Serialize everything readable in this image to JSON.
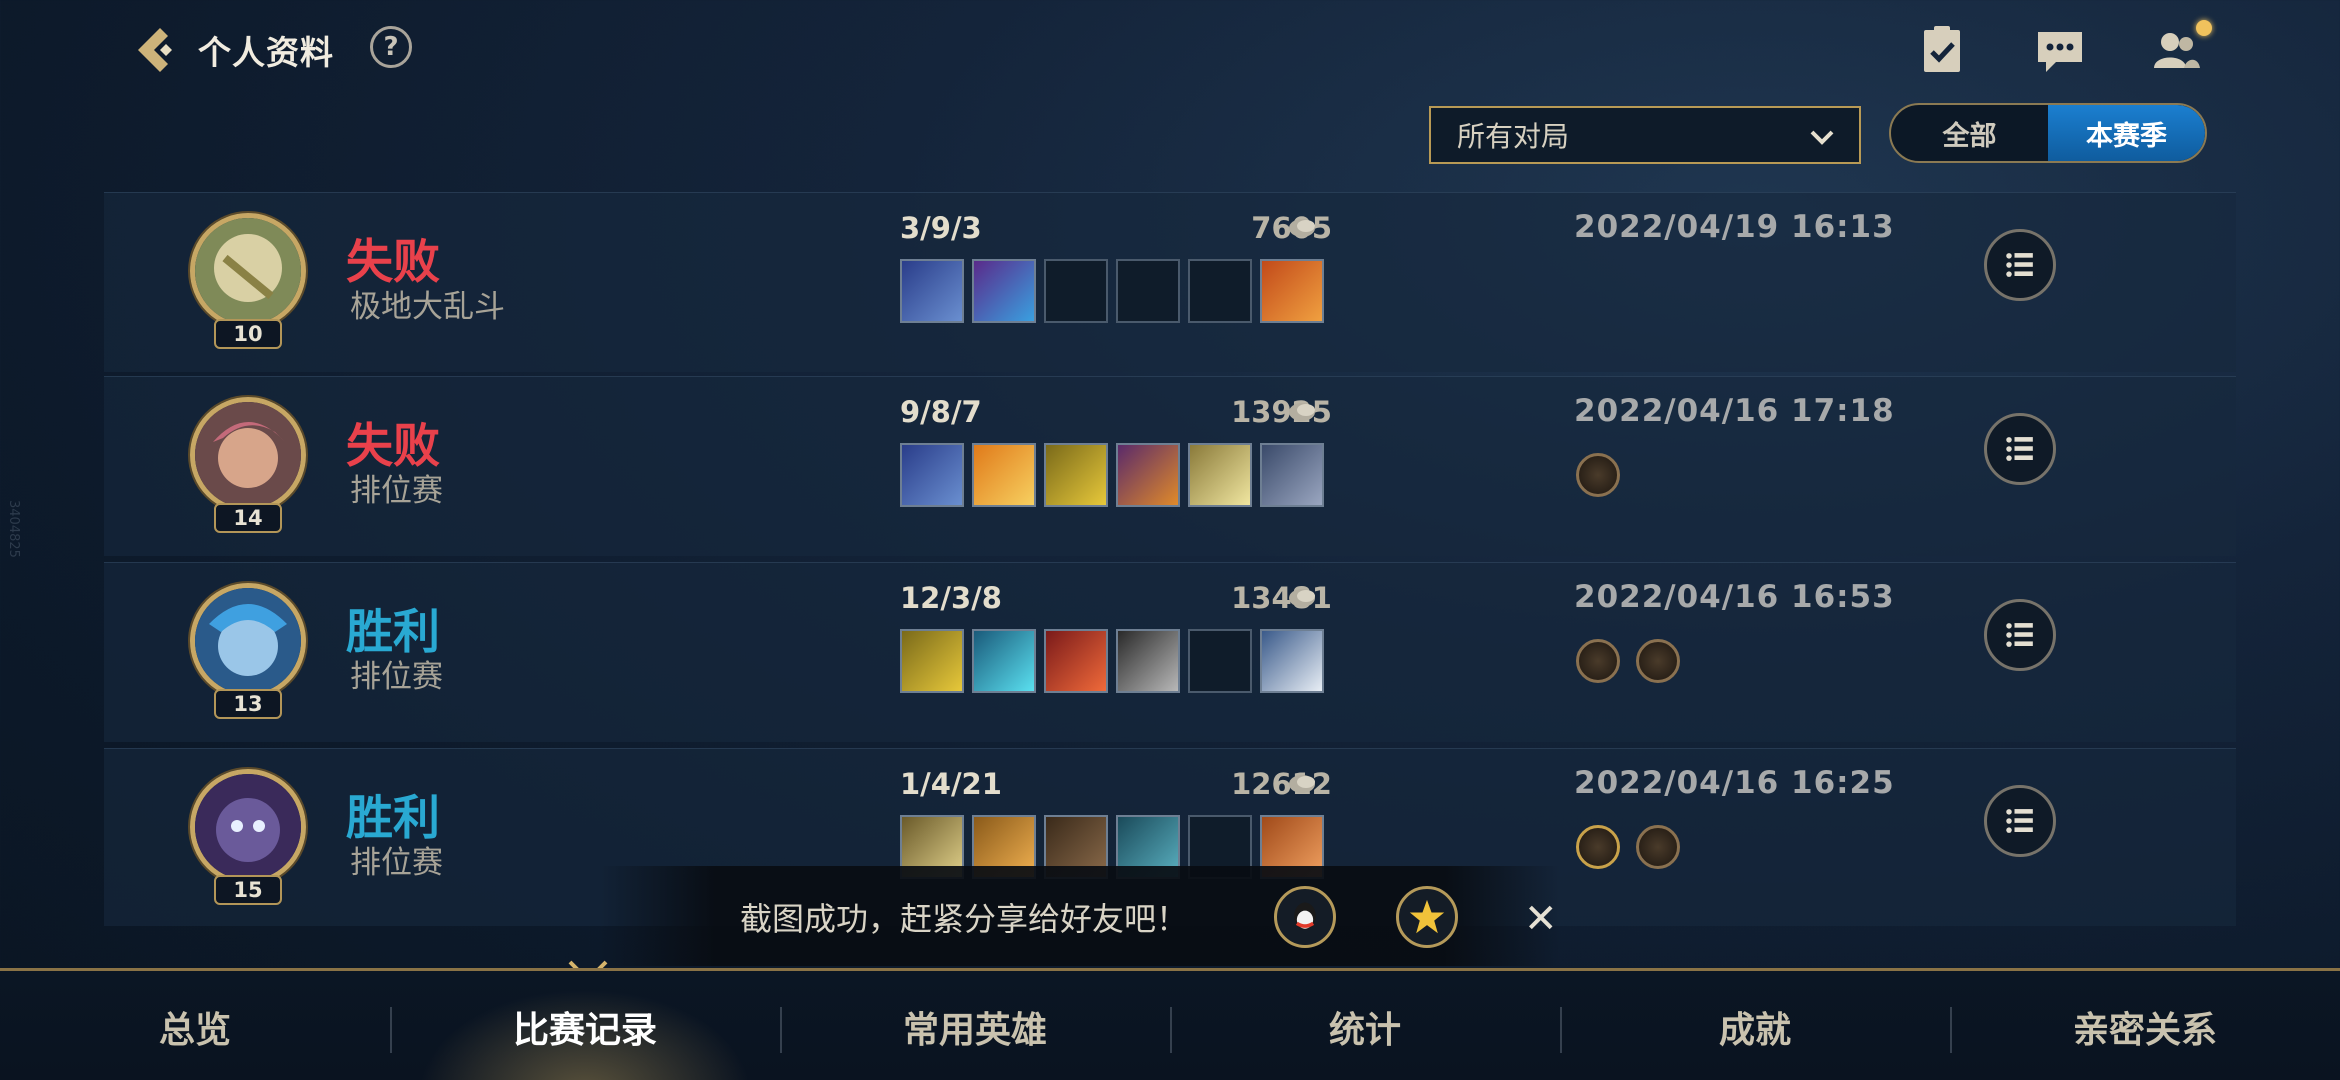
{
  "header": {
    "title": "个人资料",
    "help_label": "?"
  },
  "filters": {
    "match_type_selected": "所有对局",
    "season_options": [
      "全部",
      "本赛季"
    ],
    "season_selected": "本赛季"
  },
  "matches": [
    {
      "level": "10",
      "result": "失败",
      "mode": "极地大乱斗",
      "kda": "3/9/3",
      "gold": "7605",
      "date": "2022/04/19 16:13",
      "outcome": "lose"
    },
    {
      "level": "14",
      "result": "失败",
      "mode": "排位赛",
      "kda": "9/8/7",
      "gold": "13925",
      "date": "2022/04/16 17:18",
      "outcome": "lose"
    },
    {
      "level": "13",
      "result": "胜利",
      "mode": "排位赛",
      "kda": "12/3/8",
      "gold": "13481",
      "date": "2022/04/16 16:53",
      "outcome": "win"
    },
    {
      "level": "15",
      "result": "胜利",
      "mode": "排位赛",
      "kda": "1/4/21",
      "gold": "12612",
      "date": "2022/04/16 16:25",
      "outcome": "win"
    }
  ],
  "toast": {
    "message": "截图成功，赶紧分享给好友吧！",
    "close_label": "✕"
  },
  "bottom_nav": {
    "tabs": [
      "总览",
      "比赛记录",
      "常用英雄",
      "统计",
      "成就",
      "亲密关系"
    ],
    "active": "比赛记录"
  },
  "side_code": "3404825",
  "colors": {
    "lose": "#e9414b",
    "win": "#29a9d2",
    "gold_accent": "#c7a764",
    "active_blue": "#1b7fd0"
  }
}
